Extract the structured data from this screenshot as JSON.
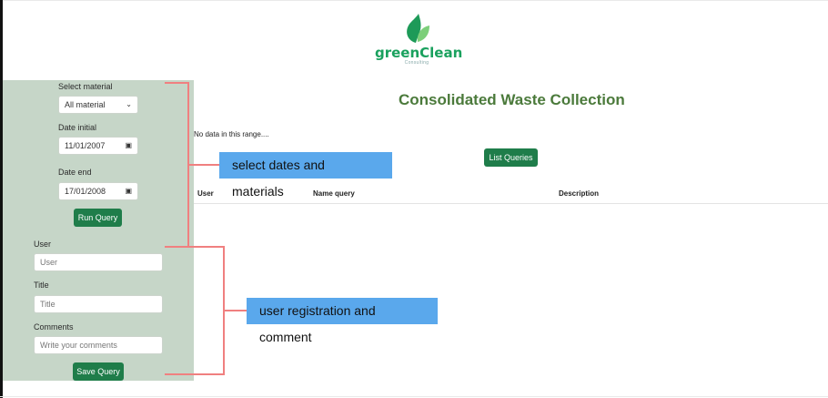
{
  "brand": {
    "name": "greenClean",
    "tagline": "Consulting",
    "accent": "#1aa15e",
    "leaf_colors": [
      "#1d9a58",
      "#7ccf7a"
    ]
  },
  "sidebar": {
    "material_label": "Select material",
    "material_value": "All material",
    "date_initial_label": "Date initial",
    "date_initial_value": "11/01/2007",
    "date_end_label": "Date end",
    "date_end_value": "17/01/2008",
    "run_button": "Run Query",
    "user_label": "User",
    "user_placeholder": "User",
    "title_label": "Title",
    "title_placeholder": "Title",
    "comments_label": "Comments",
    "comments_placeholder": "Write your comments",
    "save_button": "Save Query",
    "background": "#c6d6c8",
    "button_color": "#1f7d4a"
  },
  "main": {
    "title": "Consolidated Waste Collection",
    "title_color": "#4b7a3b",
    "no_data": "No data in this range....",
    "list_button": "List Queries",
    "columns": [
      "User",
      "Name query",
      "Description"
    ]
  },
  "annotations": [
    {
      "text": "select dates and materials",
      "color": "#5aa8ec"
    },
    {
      "text": "user registration and comment",
      "color": "#5aa8ec"
    }
  ],
  "bracket_color": "#f08080"
}
